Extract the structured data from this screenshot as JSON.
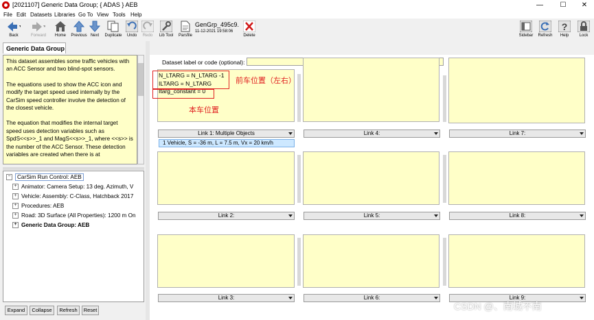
{
  "window": {
    "title": "[2021107] Generic Data Group; { ADAS } AEB",
    "controls": {
      "minimize": "—",
      "maximize": "☐",
      "close": "✕"
    }
  },
  "menu": [
    "File",
    "Edit",
    "Datasets",
    "Libraries",
    "Go To",
    "View",
    "Tools",
    "Help"
  ],
  "toolbar": {
    "back": "Back",
    "forward": "Forward",
    "home": "Home",
    "previous": "Previous",
    "next": "Next",
    "duplicate": "Duplicate",
    "undo": "Undo",
    "redo": "Redo",
    "lib_tool": "Lib Tool",
    "parsfile": "Parsfile",
    "delete": "Delete",
    "sidebar": "Sidebar",
    "refresh": "Refresh",
    "help": "Help",
    "lock": "Lock",
    "parsfile_id": "GenGrp_495c9.",
    "parsfile_date": "11-12-2021 19:58:06"
  },
  "left": {
    "tab": "Generic Data Group",
    "notes": [
      "This dataset assembles some traffic vehicles with an ACC Sensor and two blind-spot sensors.",
      "The equations used to show the ACC icon and modify the target speed used internally by the CarSim speed controller involve the detection of the closest vehicle.",
      "The equation that modifies the internal target speed uses detection variables such as SpdS<<s>>_1 and MagS<<s>>_1, where <<s>> is the number of the ACC Sensor. These detection variables are created when there is at"
    ],
    "tree": {
      "root": "CarSim Run Control: AEB",
      "items": [
        "Animator: Camera Setup: 13 deg. Azimuth, V",
        "Vehicle: Assembly: C-Class, Hatchback 2017",
        "Procedures: AEB",
        "Road: 3D Surface (All Properties): 1200 m On",
        "Generic Data Group: AEB"
      ]
    },
    "buttons": [
      "Expand",
      "Collapse",
      "Refresh",
      "Reset"
    ]
  },
  "main": {
    "dataset_label": "Dataset label or code (optional):",
    "dataset_value": "",
    "eq_lines": [
      "N_LTARG = N_LTARG -1",
      "ILTARG = N_LTARG",
      "Itarg_constant = 0"
    ],
    "annotation_front": "前车位置（左右）",
    "annotation_self": "本车位置",
    "vehicle_selected": "1 Vehicle, S = -36 m, L = 7.5 m, Vx = 20 km/h",
    "links": [
      "Link 1: Multiple Objects",
      "Link 4:",
      "Link 7:",
      "Link 2:",
      "Link 5:",
      "Link 8:",
      "Link 3:",
      "Link 6:",
      "Link 9:"
    ]
  },
  "watermark": "CSDN @、南城不南"
}
